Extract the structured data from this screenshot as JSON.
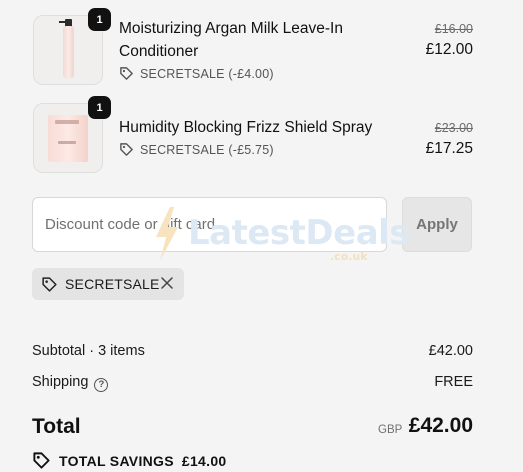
{
  "items": [
    {
      "quantity": "1",
      "name": "Moisturizing Argan Milk Leave-In Conditioner",
      "discount": "SECRETSALE (-£4.00)",
      "old_price": "£16.00",
      "price": "£12.00"
    },
    {
      "quantity": "1",
      "name": "Humidity Blocking Frizz Shield Spray",
      "discount": "SECRETSALE (-£5.75)",
      "old_price": "£23.00",
      "price": "£17.25"
    }
  ],
  "discount_form": {
    "placeholder": "Discount code or gift card",
    "apply_label": "Apply"
  },
  "applied_code": "SECRETSALE",
  "summary": {
    "subtotal_label": "Subtotal · 3 items",
    "subtotal_value": "£42.00",
    "shipping_label": "Shipping",
    "shipping_value": "FREE",
    "total_label": "Total",
    "currency": "GBP",
    "total_value": "£42.00",
    "savings_label": "TOTAL SAVINGS",
    "savings_value": "£14.00"
  },
  "watermark": {
    "main": "LatestDeals",
    "sub": ".co.uk"
  },
  "colors": {
    "background": "#f4f4f4",
    "badge": "#111111",
    "chip": "#e4e4e4"
  }
}
